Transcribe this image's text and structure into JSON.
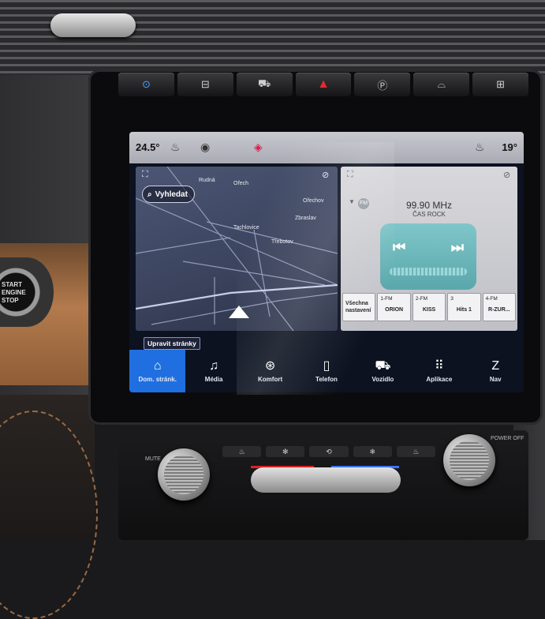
{
  "hardware_buttons": [
    {
      "icon": "auto-start-stop-icon",
      "glyph": "⊙"
    },
    {
      "icon": "parking-sensor-icon",
      "glyph": "⊟"
    },
    {
      "icon": "traction-control-icon",
      "glyph": "⛟"
    },
    {
      "icon": "hazard-icon",
      "glyph": "▲"
    },
    {
      "icon": "park-assist-icon",
      "glyph": "Ⓟ"
    },
    {
      "icon": "front-defrost-icon",
      "glyph": "⌓"
    },
    {
      "icon": "rear-defrost-icon",
      "glyph": "⊞"
    }
  ],
  "status_bar": {
    "outside_temp": "24.5°",
    "inside_temp": "19°"
  },
  "map": {
    "search_label": "Vyhledat",
    "places": [
      "Rudná",
      "Ořech",
      "Ořechov",
      "Zbraslav",
      "Tachlovice",
      "Třebotov"
    ]
  },
  "radio": {
    "frequency": "99.90 MHz",
    "station": "ČAS ROCK",
    "logo_text": "FM",
    "all_settings_label": "Všechna nastavení",
    "presets": [
      {
        "band": "1-FM",
        "name": "ORION"
      },
      {
        "band": "2-FM",
        "name": "KISS"
      },
      {
        "band": "3",
        "name": "Hits 1"
      },
      {
        "band": "4-FM",
        "name": "R-ZUR..."
      }
    ]
  },
  "edit_pages_label": "Upravit stránky",
  "dock": [
    {
      "label": "Dom. stránk.",
      "icon": "home-icon",
      "glyph": "⌂",
      "active": true
    },
    {
      "label": "Média",
      "icon": "music-note-icon",
      "glyph": "♫",
      "active": false
    },
    {
      "label": "Komfort",
      "icon": "comfort-icon",
      "glyph": "⊛",
      "active": false
    },
    {
      "label": "Telefon",
      "icon": "phone-icon",
      "glyph": "▯",
      "active": false
    },
    {
      "label": "Vozidlo",
      "icon": "vehicle-icon",
      "glyph": "⛟",
      "active": false
    },
    {
      "label": "Aplikace",
      "icon": "apps-grid-icon",
      "glyph": "⠿",
      "active": false
    },
    {
      "label": "Nav",
      "icon": "compass-nav-icon",
      "glyph": "Z",
      "active": false
    }
  ],
  "climate": {
    "mute_label": "MUTE",
    "power_label": "POWER OFF"
  }
}
